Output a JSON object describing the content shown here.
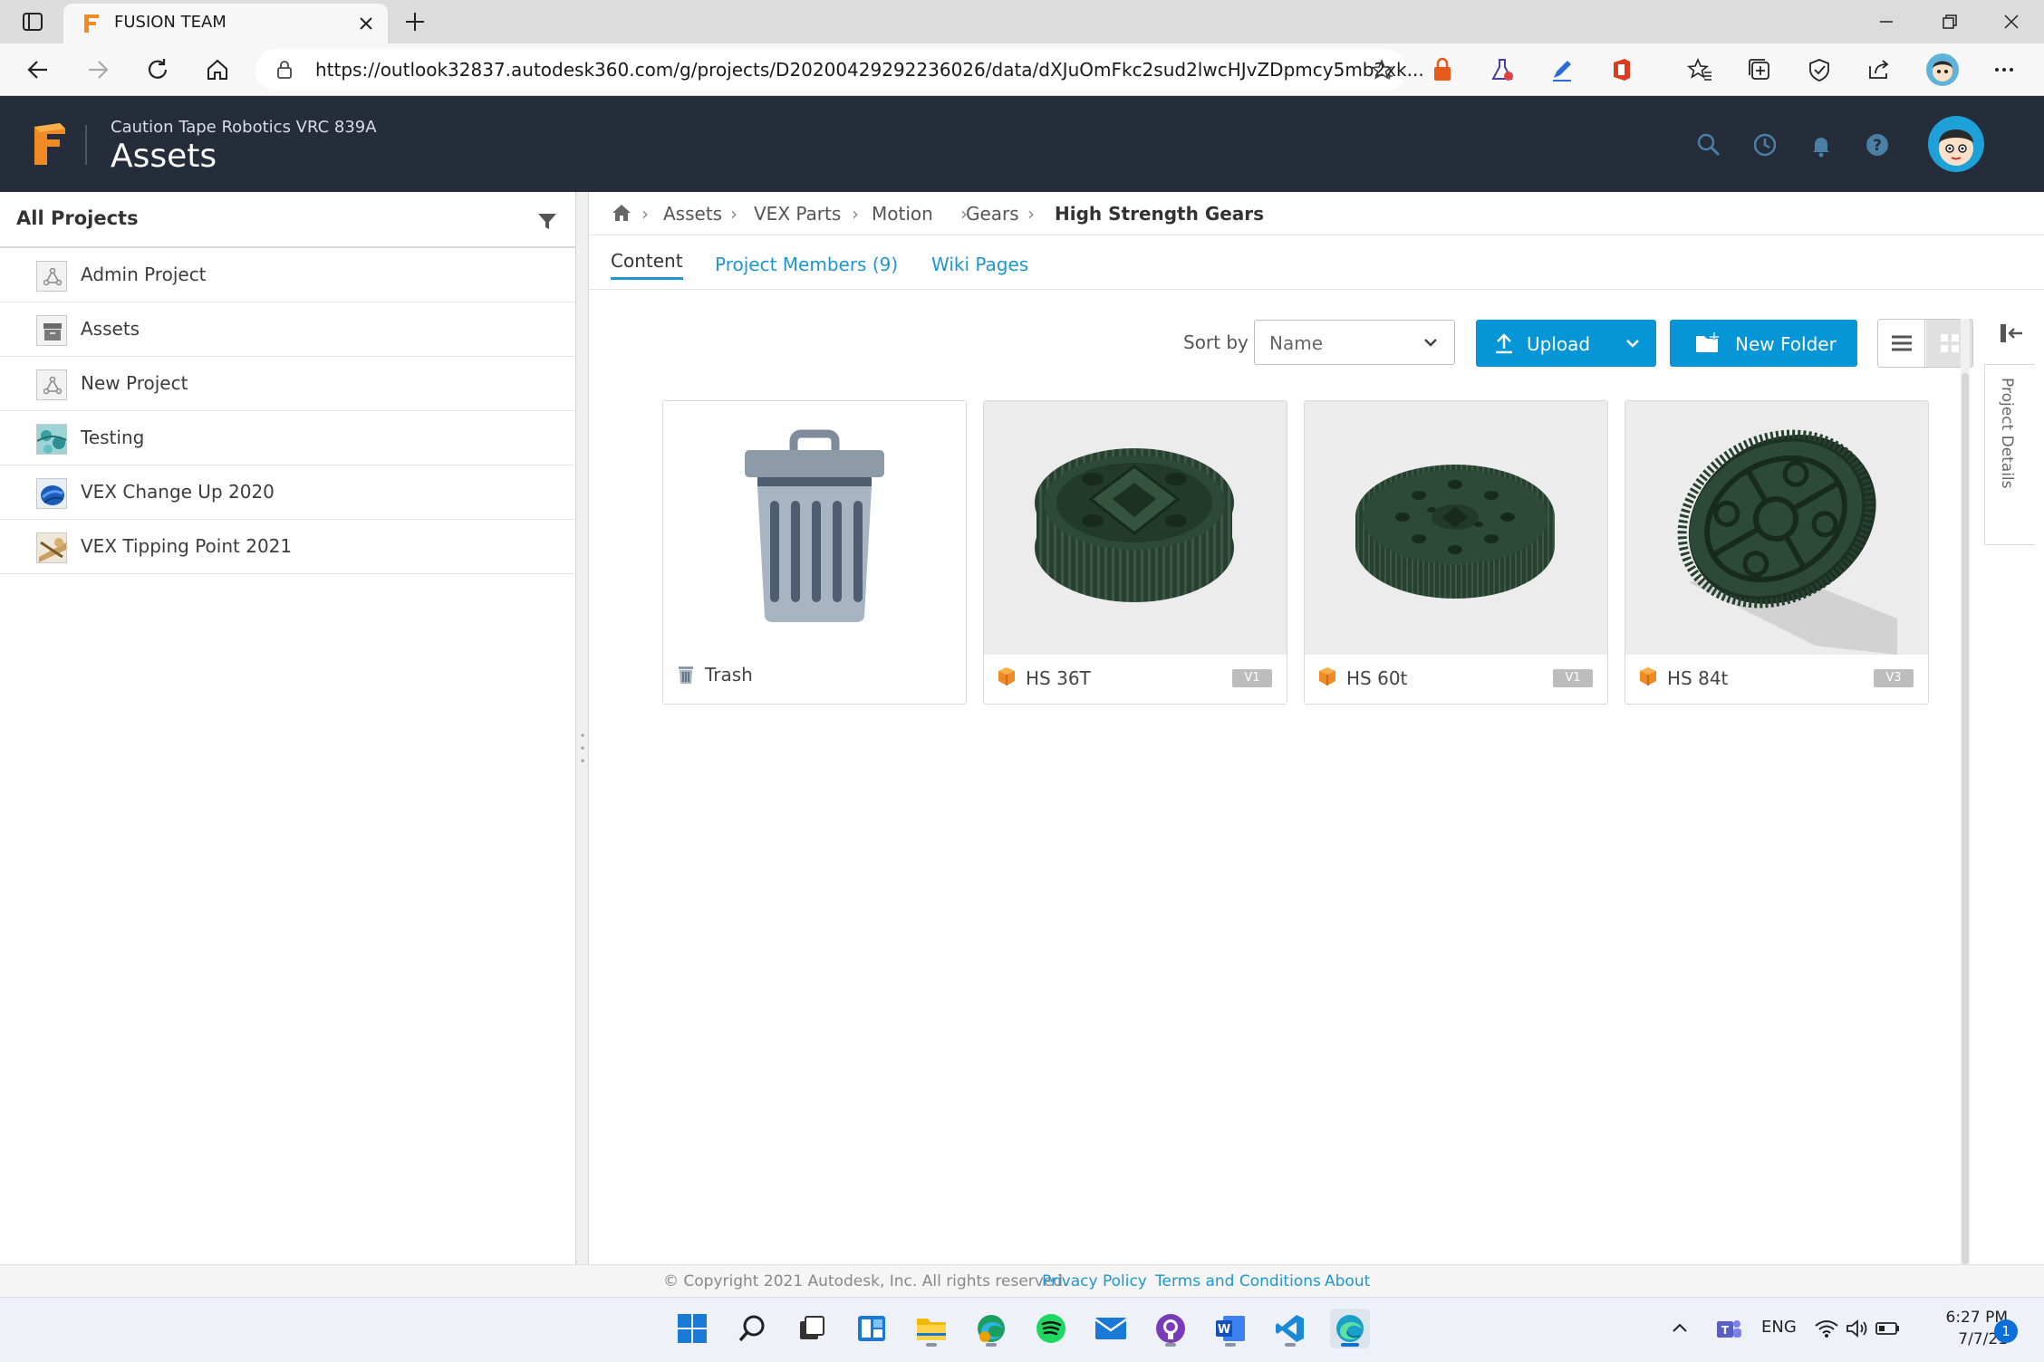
{
  "browser": {
    "tab_title": "FUSION TEAM",
    "url": "https://outlook32837.autodesk360.com/g/projects/D20200429292236026/data/dXJuOmFkc2sud2lwcHJvZDpmcy5mb2xk..."
  },
  "header": {
    "team_name": "Caution Tape Robotics VRC 839A",
    "title": "Assets"
  },
  "sidebar": {
    "title": "All Projects",
    "items": [
      {
        "label": "Admin Project",
        "thumb": "project-icon"
      },
      {
        "label": "Assets",
        "thumb": "archive-icon"
      },
      {
        "label": "New Project",
        "thumb": "project-icon"
      },
      {
        "label": "Testing",
        "thumb": "image-thumbnail"
      },
      {
        "label": "VEX Change Up 2020",
        "thumb": "image-thumbnail"
      },
      {
        "label": "VEX Tipping Point 2021",
        "thumb": "image-thumbnail"
      }
    ]
  },
  "breadcrumb": [
    "Assets",
    "VEX Parts",
    "Motion",
    "Gears",
    "High Strength Gears"
  ],
  "tabs": {
    "content": "Content",
    "members": "Project Members (9)",
    "wiki": "Wiki Pages"
  },
  "toolbar": {
    "sort_label": "Sort by",
    "sort_value": "Name",
    "upload_label": "Upload",
    "new_folder_label": "New Folder"
  },
  "files": [
    {
      "name": "Trash",
      "version": ""
    },
    {
      "name": "HS 36T",
      "version": "V1"
    },
    {
      "name": "HS 60t",
      "version": "V1"
    },
    {
      "name": "HS 84t",
      "version": "V3"
    }
  ],
  "right_panel": {
    "label": "Project Details"
  },
  "footer": {
    "copyright": "© Copyright 2021 Autodesk, Inc. All rights reserved.",
    "privacy": "Privacy Policy",
    "terms": "Terms and Conditions",
    "about": "About"
  },
  "taskbar": {
    "language": "ENG",
    "time": "6:27 PM",
    "date": "7/7/21",
    "notifications": "1"
  },
  "colors": {
    "header_bg": "#252c3a",
    "accent": "#0696d7",
    "link": "#1c97d0",
    "gear": "#2c4a37"
  }
}
